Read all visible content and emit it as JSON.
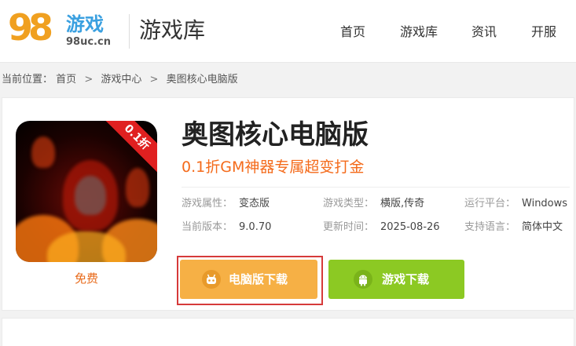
{
  "header": {
    "logo": {
      "digits": "98",
      "brand": "游戏",
      "domain": "98uc.cn"
    },
    "title": "游戏库",
    "nav": [
      "首页",
      "游戏库",
      "资讯",
      "开服"
    ]
  },
  "breadcrumb": {
    "prefix": "当前位置：",
    "items": [
      "首页",
      "游戏中心",
      "奥图核心电脑版"
    ],
    "separator": ">"
  },
  "game": {
    "icon_badge": "0.1折",
    "price_label": "免费",
    "title": "奥图核心电脑版",
    "subtitle": "0.1折GM神器专属超变打金",
    "attributes": [
      {
        "key": "游戏属性：",
        "value": "变态版"
      },
      {
        "key": "游戏类型：",
        "value": "横版,传奇"
      },
      {
        "key": "运行平台：",
        "value": "Windows"
      },
      {
        "key": "当前版本：",
        "value": "9.0.70"
      },
      {
        "key": "更新时间：",
        "value": "2025-08-26"
      },
      {
        "key": "支持语言：",
        "value": "简体中文"
      }
    ],
    "buttons": {
      "pc_download": "电脑版下载",
      "game_download": "游戏下载"
    }
  },
  "colors": {
    "accent_orange": "#f46a1a",
    "pc_button": "#f6b045",
    "game_button": "#8cc923",
    "highlight_border": "#d63a3a",
    "badge_red": "#e02020"
  },
  "icons": {
    "pc_button_icon": "robot-icon",
    "game_button_icon": "android-icon"
  }
}
